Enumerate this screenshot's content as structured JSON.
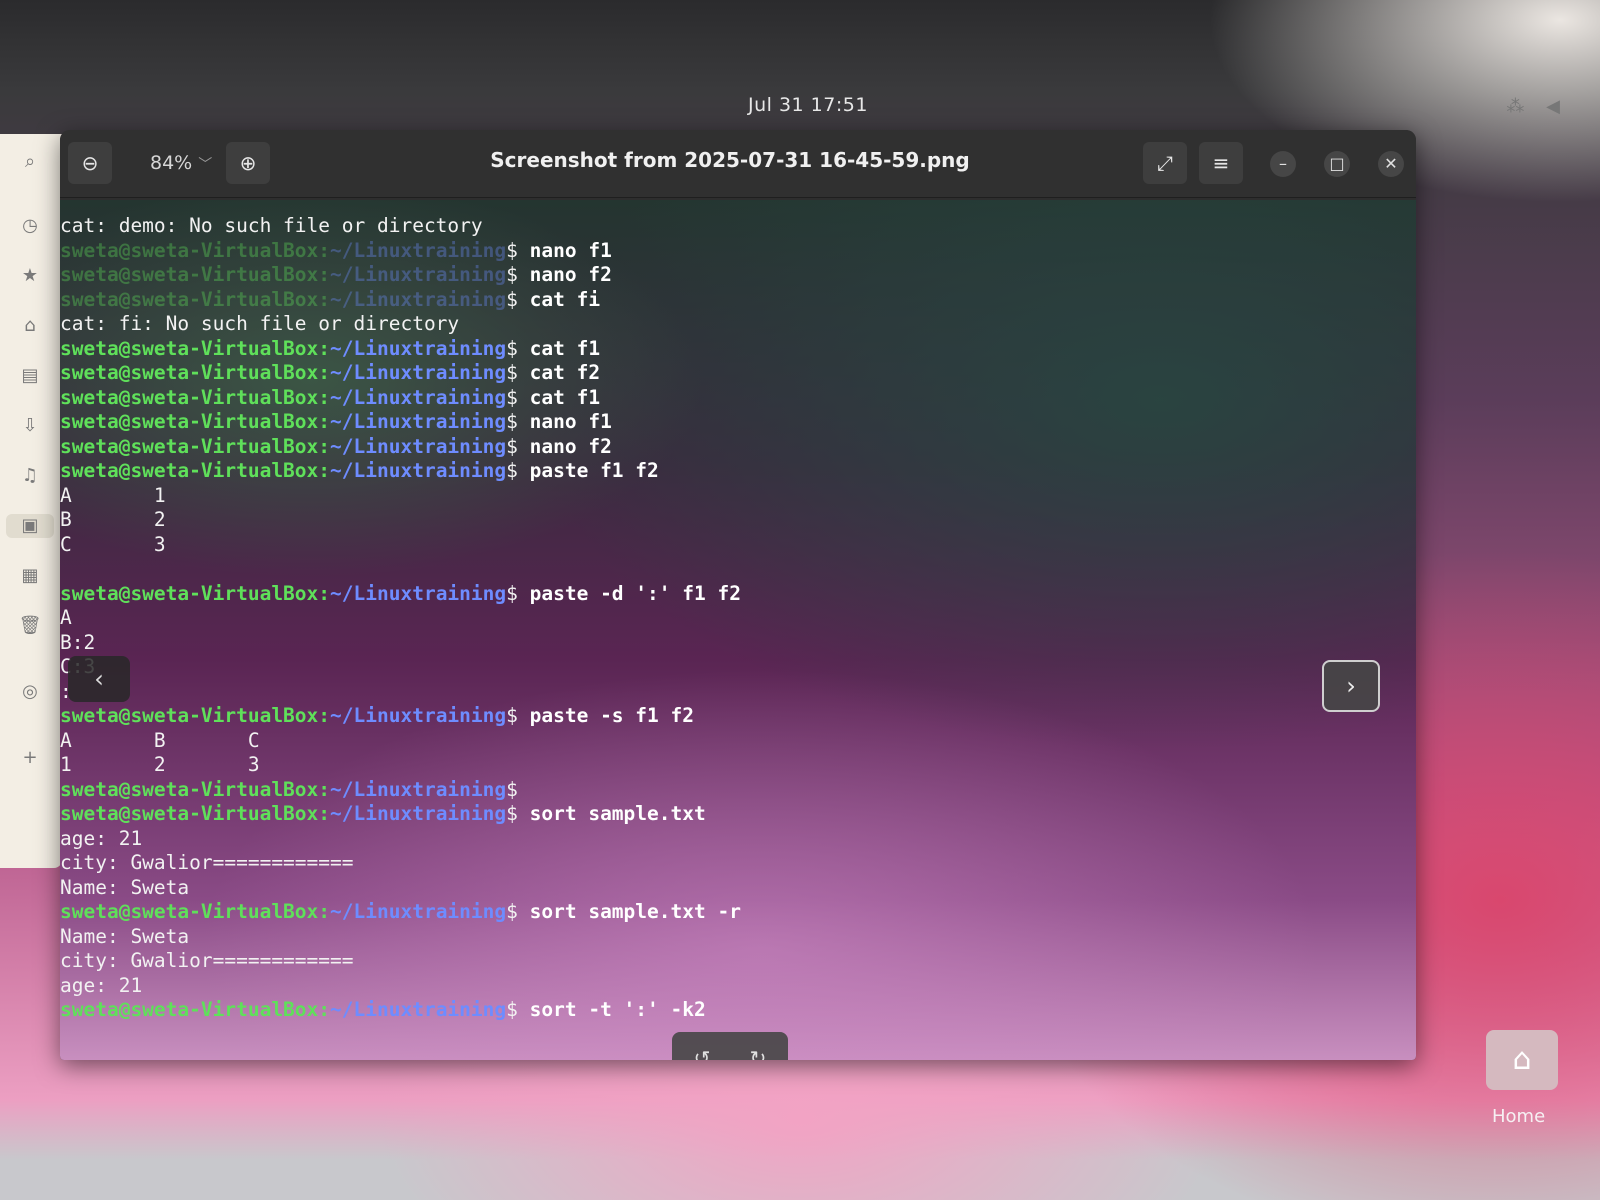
{
  "topbar": {
    "clock": "Jul 31  17:51"
  },
  "viewer": {
    "title": "Screenshot from 2025-07-31 16-45-59.png",
    "zoom_level": "84%",
    "icons": {
      "zoom_out": "zoom-out-icon",
      "zoom_in": "zoom-in-icon",
      "fullscreen": "fullscreen-icon",
      "menu": "hamburger-menu-icon",
      "minimize": "minimize-icon",
      "maximize": "maximize-icon",
      "close": "close-icon",
      "prev": "chevron-left-icon",
      "next": "chevron-right-icon",
      "rotate_left": "rotate-left-icon",
      "rotate_right": "rotate-right-icon"
    }
  },
  "terminal": {
    "prompt_user": "sweta@sweta-VirtualBox:",
    "prompt_path": "~/Linuxtraining",
    "lines": [
      {
        "type": "out",
        "text": "cat: demo: No such file or directory"
      },
      {
        "type": "cmd",
        "dim": true,
        "cmd": "nano f1"
      },
      {
        "type": "cmd",
        "dim": true,
        "cmd": "nano f2"
      },
      {
        "type": "cmd",
        "dim": true,
        "cmd": "cat fi"
      },
      {
        "type": "out",
        "text": "cat: fi: No such file or directory"
      },
      {
        "type": "cmd",
        "cmd": "cat f1"
      },
      {
        "type": "cmd",
        "cmd": "cat f2"
      },
      {
        "type": "cmd",
        "cmd": "cat f1"
      },
      {
        "type": "cmd",
        "cmd": "nano f1"
      },
      {
        "type": "cmd",
        "cmd": "nano f2"
      },
      {
        "type": "cmd",
        "cmd": "paste f1 f2"
      },
      {
        "type": "out",
        "text": "A       1"
      },
      {
        "type": "out",
        "text": "B       2"
      },
      {
        "type": "out",
        "text": "C       3"
      },
      {
        "type": "out",
        "text": ""
      },
      {
        "type": "cmd",
        "cmd": "paste -d ':' f1 f2"
      },
      {
        "type": "out",
        "text": "A"
      },
      {
        "type": "out",
        "text": "B:2"
      },
      {
        "type": "out",
        "text": "C:3"
      },
      {
        "type": "out",
        "text": ":"
      },
      {
        "type": "cmd",
        "cmd": "paste -s f1 f2"
      },
      {
        "type": "out",
        "text": "A       B       C"
      },
      {
        "type": "out",
        "text": "1       2       3"
      },
      {
        "type": "cmd",
        "cmd": ""
      },
      {
        "type": "cmd",
        "cmd": "sort sample.txt"
      },
      {
        "type": "out",
        "text": "age: 21"
      },
      {
        "type": "out",
        "text": "city: Gwalior============"
      },
      {
        "type": "out",
        "text": "Name: Sweta"
      },
      {
        "type": "cmd",
        "cmd": "sort sample.txt -r"
      },
      {
        "type": "out",
        "text": "Name: Sweta"
      },
      {
        "type": "out",
        "text": "city: Gwalior============"
      },
      {
        "type": "out",
        "text": "age: 21"
      },
      {
        "type": "cmd",
        "cmd": "sort -t ':' -k2"
      }
    ]
  },
  "desktop": {
    "home_label": "Home"
  }
}
